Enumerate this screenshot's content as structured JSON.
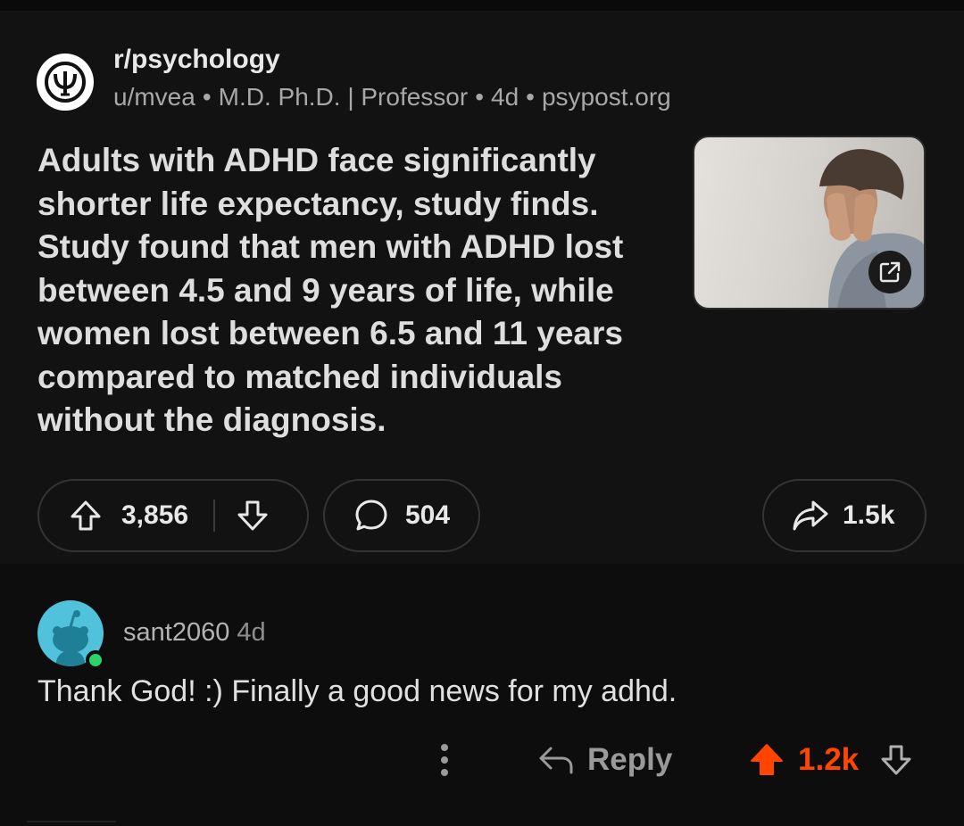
{
  "post": {
    "subreddit": "r/psychology",
    "author": "u/mvea",
    "flair": "M.D. Ph.D. | Professor",
    "age": "4d",
    "domain": "psypost.org",
    "title": "Adults with ADHD face significantly shorter life expectancy, study finds. Study found that men with ADHD lost between 4.5 and 9 years of life, while women lost between 6.5 and 11 years compared to matched individuals without the diagnosis.",
    "upvotes": "3,856",
    "comments": "504",
    "shares": "1.5k"
  },
  "comment": {
    "username": "sant2060",
    "age": "4d",
    "body": "Thank God! :) Finally a good news for my adhd.",
    "reply_label": "Reply",
    "score": "1.2k",
    "vote_state": "upvoted"
  },
  "icons": {
    "subreddit": "psi-symbol-icon",
    "external_link": "external-link-icon",
    "upvote": "arrow-up-icon",
    "downvote": "arrow-down-icon",
    "comment": "speech-bubble-icon",
    "share": "share-arrow-icon",
    "more": "vertical-dots-icon",
    "reply": "reply-arrow-icon"
  },
  "colors": {
    "background": "#0d0d0d",
    "card": "#121212",
    "upvote_active": "#ff4500",
    "avatar": "#51c2dc",
    "online": "#2bd46b"
  }
}
